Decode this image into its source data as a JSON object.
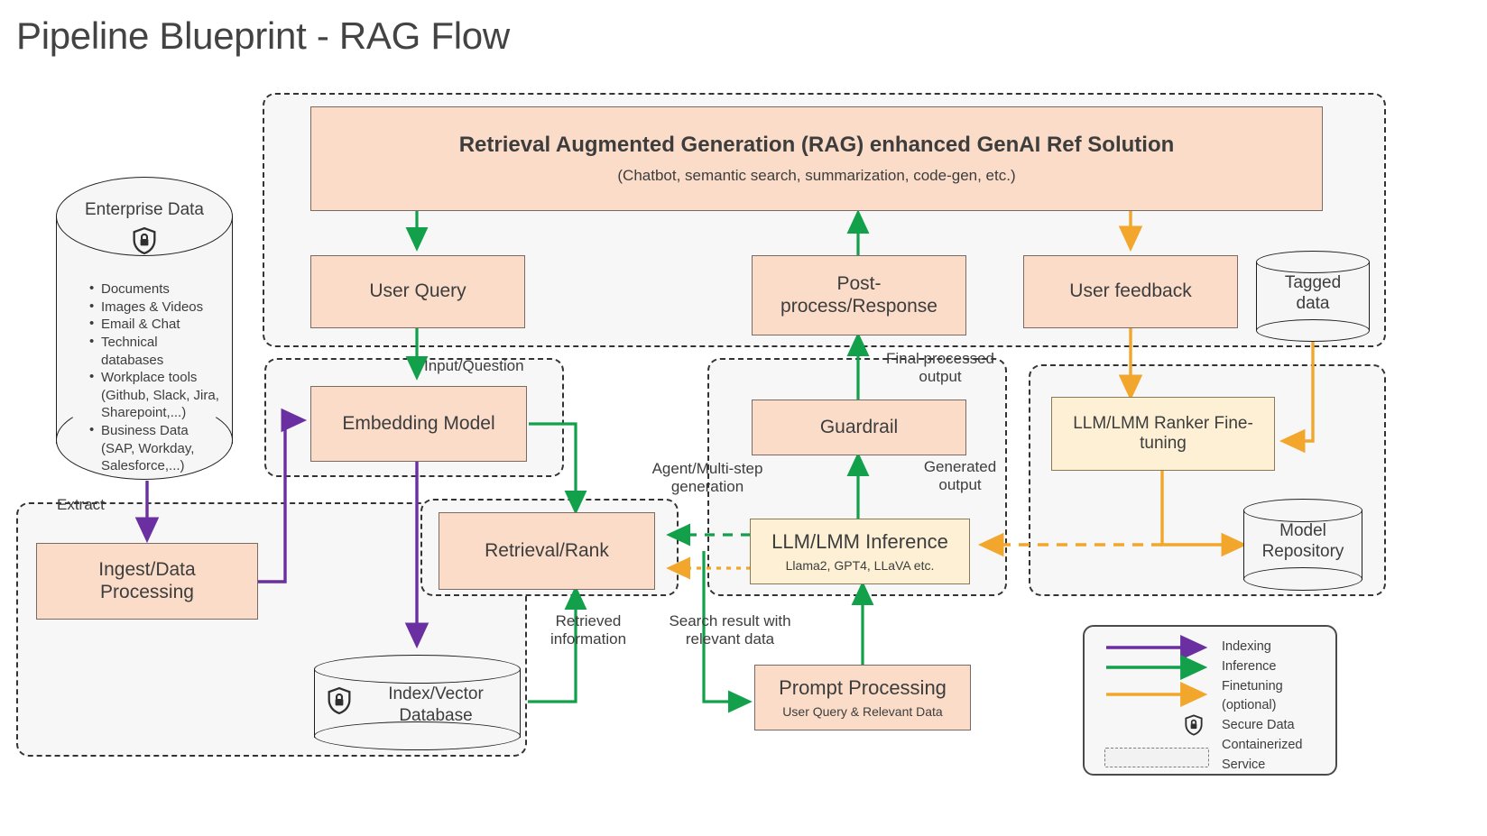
{
  "title": "Pipeline Blueprint - RAG Flow",
  "colors": {
    "indexing": "#6a2fa0",
    "inference": "#12a04a",
    "finetuning": "#f2a62b",
    "box_fill": "#fadcc9",
    "box_fill_yellow": "#fdf0d5",
    "container_bg": "#f7f7f7"
  },
  "enterprise_data": {
    "label": "Enterprise Data",
    "icon": "shield-lock-icon",
    "items": [
      "Documents",
      "Images & Videos",
      "Email & Chat",
      "Technical",
      "databases",
      "Workplace tools",
      "(Github, Slack, Jira,",
      "Sharepoint,...)",
      "Business Data",
      "(SAP, Workday,",
      "Salesforce,...)"
    ]
  },
  "boxes": {
    "rag_solution": {
      "title": "Retrieval Augmented Generation (RAG) enhanced GenAI Ref Solution",
      "subtitle": "(Chatbot, semantic search, summarization, code-gen, etc.)"
    },
    "user_query": {
      "title": "User Query"
    },
    "post_process": {
      "title": "Post-\nprocess/Response"
    },
    "user_feedback": {
      "title": "User feedback"
    },
    "embedding_model": {
      "title": "Embedding Model"
    },
    "guardrail": {
      "title": "Guardrail"
    },
    "ranker_finetuning": {
      "title": "LLM/LMM Ranker Fine-\ntuning"
    },
    "ingest": {
      "title": "Ingest/Data\nProcessing"
    },
    "retrieval_rank": {
      "title": "Retrieval/Rank"
    },
    "llm_inference": {
      "title": "LLM/LMM Inference",
      "subtitle": "Llama2, GPT4, LLaVA etc."
    },
    "prompt_processing": {
      "title": "Prompt Processing",
      "subtitle": "User Query & Relevant Data"
    }
  },
  "cylinders": {
    "tagged_data": {
      "label": "Tagged\ndata"
    },
    "model_repository": {
      "label": "Model\nRepository"
    },
    "index_vector_db": {
      "label": "Index/Vector\nDatabase",
      "icon": "shield-lock-icon"
    }
  },
  "edge_labels": {
    "extract": "Extract",
    "input_question": "Input/Question",
    "agent_multistep": "Agent/Multi-step\ngeneration",
    "final_processed": "Final processed\noutput",
    "generated_output": "Generated\noutput",
    "retrieved_information": "Retrieved\ninformation",
    "search_result": "Search result with\nrelevant data"
  },
  "legend": {
    "rows": [
      "Indexing",
      "Inference",
      "Finetuning",
      "(optional)",
      "Secure Data",
      "Containerized",
      "Service"
    ],
    "arrow_indexing_color": "#6a2fa0",
    "arrow_inference_color": "#12a04a",
    "arrow_finetuning_color": "#f2a62b",
    "secure_icon": "shield-lock-icon",
    "container_icon": "dashed-box-icon"
  }
}
